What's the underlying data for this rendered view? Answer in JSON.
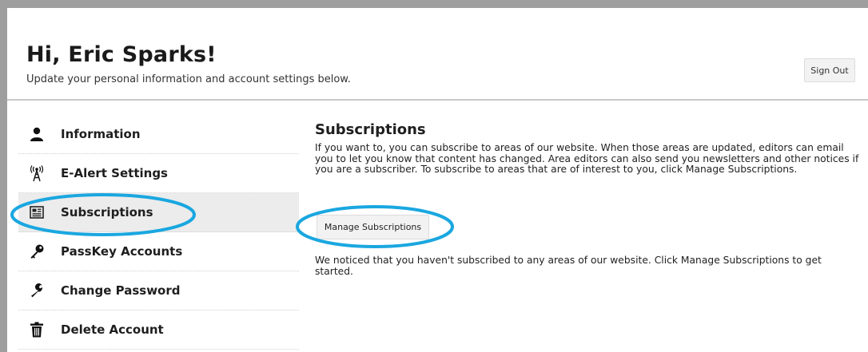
{
  "header": {
    "greeting": "Hi, Eric Sparks!",
    "subtitle": "Update your personal information and account settings below.",
    "sign_out_label": "Sign Out"
  },
  "sidebar": {
    "items": [
      {
        "label": "Information",
        "icon": "user-icon",
        "active": false
      },
      {
        "label": "E-Alert Settings",
        "icon": "antenna-icon",
        "active": false
      },
      {
        "label": "Subscriptions",
        "icon": "newspaper-icon",
        "active": true
      },
      {
        "label": "PassKey Accounts",
        "icon": "key-icon",
        "active": false
      },
      {
        "label": "Change Password",
        "icon": "wrench-icon",
        "active": false
      },
      {
        "label": "Delete Account",
        "icon": "trash-icon",
        "active": false
      }
    ]
  },
  "main": {
    "title": "Subscriptions",
    "description": "If you want to, you can subscribe to areas of our website. When those areas are updated, editors can email you to let you know that content has changed. Area editors can also send you newsletters and other notices if you are a subscriber. To subscribe to areas that are of interest to you, click Manage Subscriptions.",
    "manage_button_label": "Manage Subscriptions",
    "notice": "We noticed that you haven't subscribed to any areas of our website. Click Manage Subscriptions to get started."
  },
  "colors": {
    "highlight_ring": "#1aa7e0",
    "frame": "#9e9e9e",
    "active_item_bg": "#ececec"
  }
}
